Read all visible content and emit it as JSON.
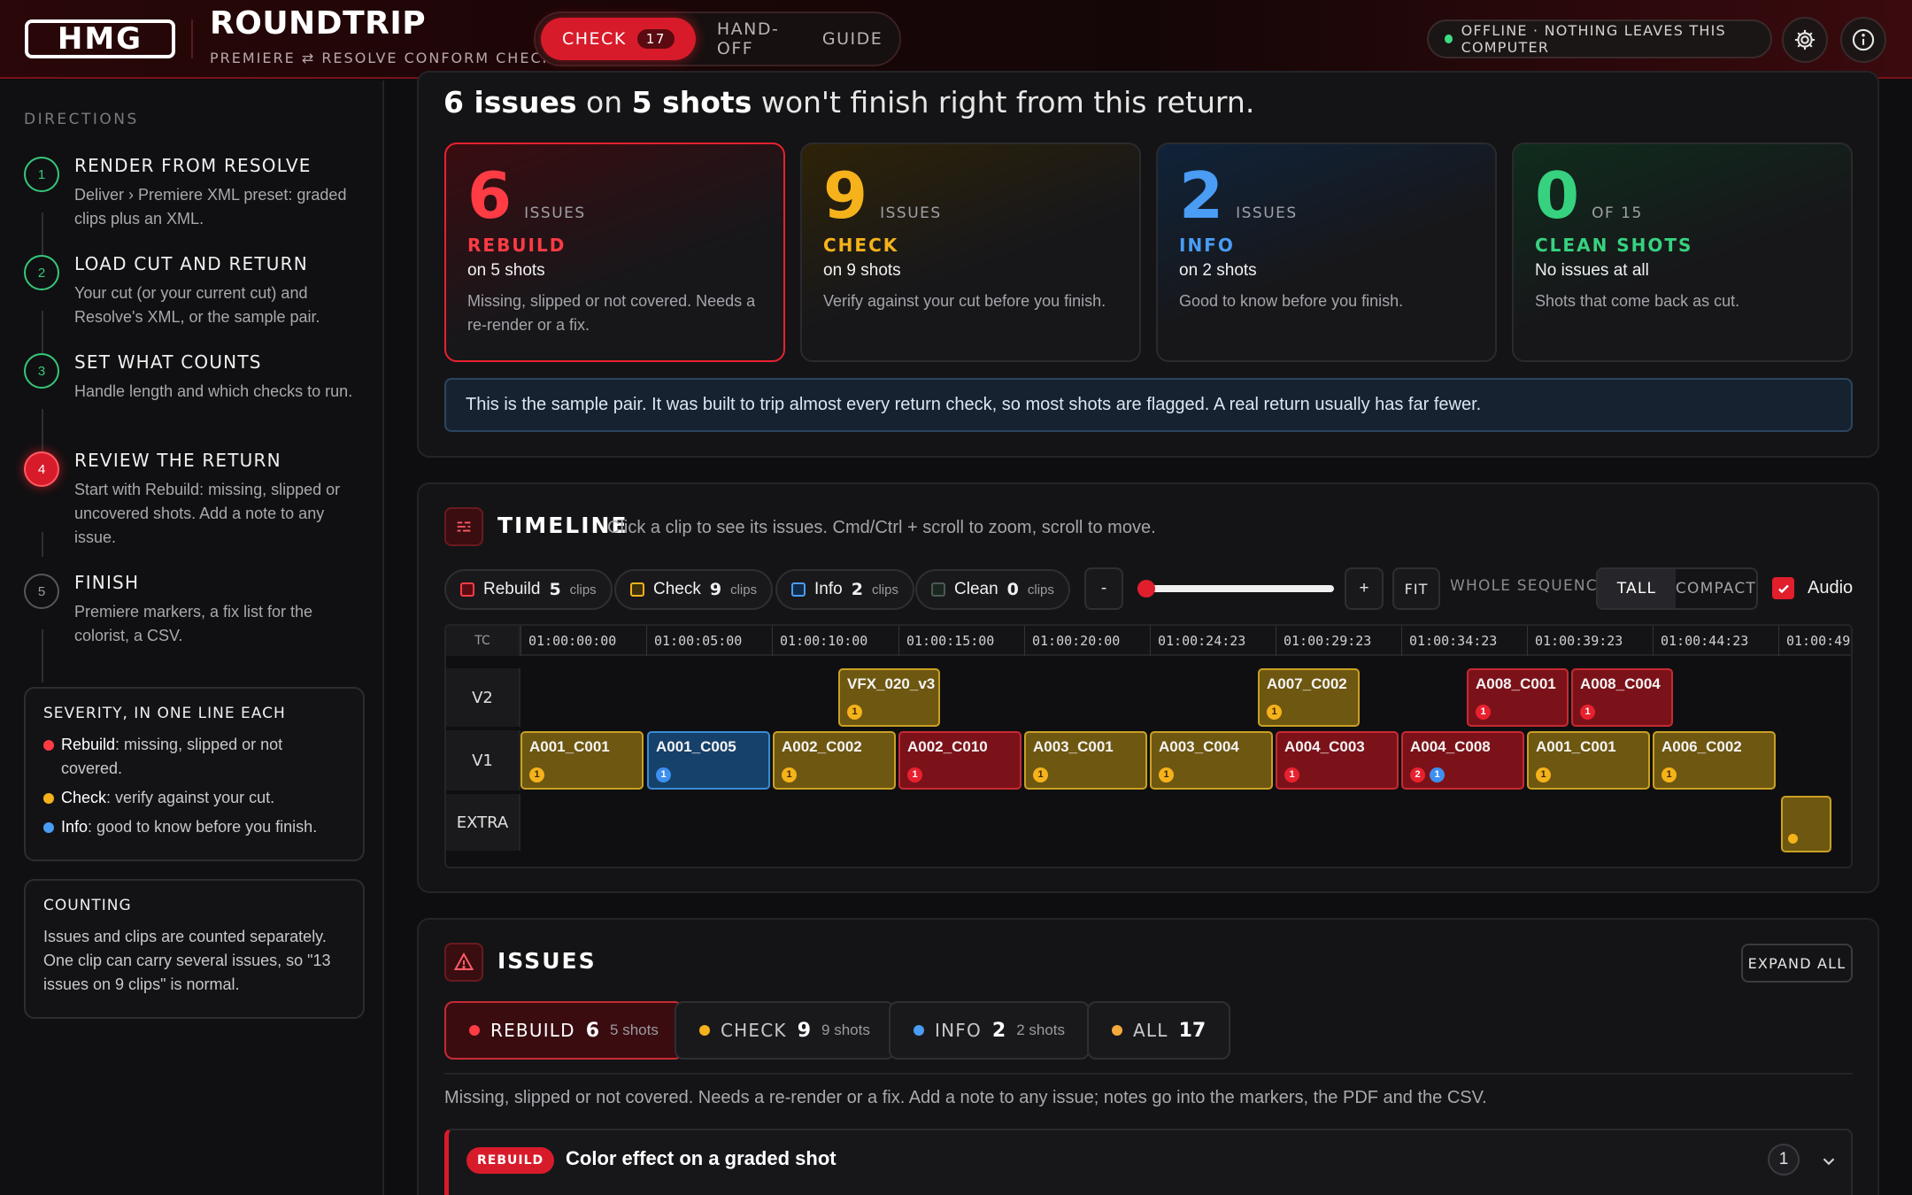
{
  "header": {
    "logo": "HMG",
    "title": "ROUNDTRIP",
    "subtitle": "PREMIERE ⇄ RESOLVE CONFORM CHECK",
    "tabs": [
      {
        "label": "CHECK",
        "count": "17"
      },
      {
        "label": "HAND-OFF"
      },
      {
        "label": "GUIDE"
      }
    ],
    "offline": "OFFLINE · NOTHING LEAVES THIS COMPUTER"
  },
  "sidebar": {
    "directions_title": "DIRECTIONS",
    "steps": [
      {
        "n": "1",
        "title": "RENDER FROM RESOLVE",
        "desc": "Deliver › Premiere XML preset: graded clips plus an XML."
      },
      {
        "n": "2",
        "title": "LOAD CUT AND RETURN",
        "desc": "Your cut (or your current cut) and Resolve's XML, or the sample pair."
      },
      {
        "n": "3",
        "title": "SET WHAT COUNTS",
        "desc": "Handle length and which checks to run."
      },
      {
        "n": "4",
        "title": "REVIEW THE RETURN",
        "desc": "Start with Rebuild: missing, slipped or uncovered shots. Add a note to any issue."
      },
      {
        "n": "5",
        "title": "FINISH",
        "desc": "Premiere markers, a fix list for the colorist, a CSV."
      }
    ],
    "severity": {
      "title": "SEVERITY, IN ONE LINE EACH",
      "items": [
        {
          "name": "Rebuild",
          "text": ": missing, slipped or not covered."
        },
        {
          "name": "Check",
          "text": ": verify against your cut."
        },
        {
          "name": "Info",
          "text": ": good to know before you finish."
        }
      ]
    },
    "counting": {
      "title": "COUNTING",
      "text": "Issues and clips are counted separately. One clip can carry several issues, so \"13 issues on 9 clips\" is normal."
    }
  },
  "summary": {
    "h_issues": "6 issues",
    "h_on": " on ",
    "h_shots": "5 shots",
    "h_rest": " won't finish right from this return.",
    "cards": [
      {
        "num": "6",
        "unit": "ISSUES",
        "label": "REBUILD",
        "on": "on 5 shots",
        "desc": "Missing, slipped or not covered. Needs a re-render or a fix.",
        "color": "#ff3b44"
      },
      {
        "num": "9",
        "unit": "ISSUES",
        "label": "CHECK",
        "on": "on 9 shots",
        "desc": "Verify against your cut before you finish.",
        "color": "#f5b21b"
      },
      {
        "num": "2",
        "unit": "ISSUES",
        "label": "INFO",
        "on": "on 2 shots",
        "desc": "Good to know before you finish.",
        "color": "#4a9cf5"
      },
      {
        "num": "0",
        "unit": "OF 15",
        "label": "CLEAN SHOTS",
        "on": "No issues at all",
        "desc": "Shots that come back as cut.",
        "color": "#37d27f"
      }
    ],
    "note": "This is the sample pair. It was built to trip almost every return check, so most shots are flagged. A real return usually has far fewer."
  },
  "timeline": {
    "title": "TIMELINE",
    "subtitle": "Click a clip to see its issues. Cmd/Ctrl + scroll to zoom, scroll to move.",
    "chips": [
      {
        "label": "Rebuild",
        "count": "5",
        "unit": "clips"
      },
      {
        "label": "Check",
        "count": "9",
        "unit": "clips"
      },
      {
        "label": "Info",
        "count": "2",
        "unit": "clips"
      },
      {
        "label": "Clean",
        "count": "0",
        "unit": "clips"
      }
    ],
    "zoom_out": "-",
    "zoom_in": "+",
    "zoom_level": 0,
    "fit": "FIT",
    "whole": "WHOLE SEQUENCE",
    "view": [
      "TALL",
      "COMPACT"
    ],
    "audio": "Audio",
    "ruler_label": "TC",
    "ticks": [
      "01:00:00:00",
      "01:00:05:00",
      "01:00:10:00",
      "01:00:15:00",
      "01:00:20:00",
      "01:00:24:23",
      "01:00:29:23",
      "01:00:34:23",
      "01:00:39:23",
      "01:00:44:23",
      "01:00:49"
    ],
    "tracks": [
      "V2",
      "V1",
      "EXTRA"
    ],
    "v2": [
      {
        "name": "VFX_020_v3",
        "sev": "y",
        "badges": [
          {
            "t": "y",
            "n": "1"
          }
        ]
      },
      {
        "name": "A007_C002",
        "sev": "y",
        "badges": [
          {
            "t": "y",
            "n": "1"
          }
        ]
      },
      {
        "name": "A008_C001",
        "sev": "r",
        "badges": [
          {
            "t": "r",
            "n": "1"
          }
        ]
      },
      {
        "name": "A008_C004",
        "sev": "r",
        "badges": [
          {
            "t": "r",
            "n": "1"
          }
        ]
      }
    ],
    "v1": [
      {
        "name": "A001_C001",
        "sev": "y",
        "badges": [
          {
            "t": "y",
            "n": "1"
          }
        ]
      },
      {
        "name": "A001_C005",
        "sev": "b",
        "badges": [
          {
            "t": "b",
            "n": "1"
          }
        ]
      },
      {
        "name": "A002_C002",
        "sev": "y",
        "badges": [
          {
            "t": "y",
            "n": "1"
          }
        ]
      },
      {
        "name": "A002_C010",
        "sev": "r",
        "badges": [
          {
            "t": "r",
            "n": "1"
          }
        ]
      },
      {
        "name": "A003_C001",
        "sev": "y",
        "badges": [
          {
            "t": "y",
            "n": "1"
          }
        ]
      },
      {
        "name": "A003_C004",
        "sev": "y",
        "badges": [
          {
            "t": "y",
            "n": "1"
          }
        ]
      },
      {
        "name": "A004_C003",
        "sev": "r",
        "badges": [
          {
            "t": "r",
            "n": "1"
          }
        ]
      },
      {
        "name": "A004_C008",
        "sev": "r",
        "badges": [
          {
            "t": "r",
            "n": "2"
          },
          {
            "t": "b",
            "n": "1"
          }
        ]
      },
      {
        "name": "A001_C001",
        "sev": "y",
        "badges": [
          {
            "t": "y",
            "n": "1"
          }
        ]
      },
      {
        "name": "A006_C002",
        "sev": "y",
        "badges": [
          {
            "t": "y",
            "n": "1"
          }
        ]
      }
    ]
  },
  "issues": {
    "title": "ISSUES",
    "expand": "EXPAND ALL",
    "filters": [
      {
        "label": "REBUILD",
        "count": "6",
        "sub": "5 shots",
        "color": "#ff3b44"
      },
      {
        "label": "CHECK",
        "count": "9",
        "sub": "9 shots",
        "color": "#f5b21b"
      },
      {
        "label": "INFO",
        "count": "2",
        "sub": "2 shots",
        "color": "#4a9cf5"
      },
      {
        "label": "ALL",
        "count": "17",
        "sub": "",
        "color": "#f5a93b"
      }
    ],
    "filter_desc": "Missing, slipped or not covered. Needs a re-render or a fix. Add a note to any issue; notes go into the markers, the PDF and the CSV.",
    "first": {
      "tag": "REBUILD",
      "title": "Color effect on a graded shot",
      "count": "1"
    }
  }
}
